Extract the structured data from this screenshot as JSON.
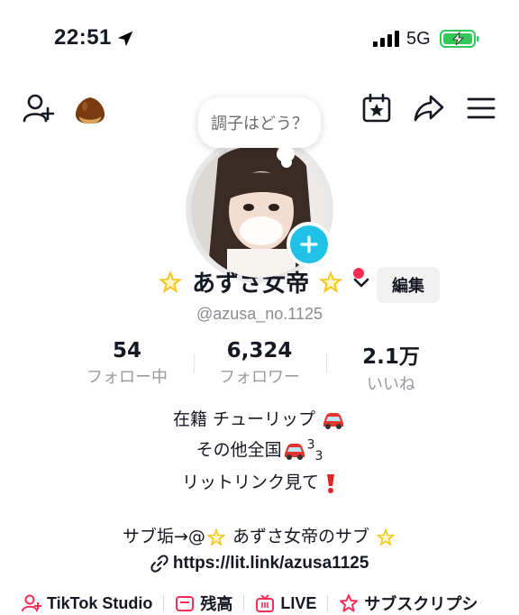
{
  "status_bar": {
    "time": "22:51",
    "network": "5G"
  },
  "toolbar": {
    "left_icons": [
      "add-friend-icon",
      "chestnut-icon"
    ],
    "right_icons": [
      "calendar-star-icon",
      "share-icon",
      "menu-icon"
    ]
  },
  "bubble": {
    "text": "調子はどう？"
  },
  "profile": {
    "name": "あずさ女帝",
    "handle": "@azusa_no.1125",
    "edit_label": "編集"
  },
  "stats": [
    {
      "value": "54",
      "label": "フォロー中"
    },
    {
      "value": "6,324",
      "label": "フォロワー"
    },
    {
      "value": "2.1万",
      "label": "いいね"
    }
  ],
  "bio": {
    "line1": "在籍 チューリップ",
    "line2a": "その他全国",
    "line2b": "3",
    "line2c": "3",
    "line3": "リットリンク見て",
    "line4a": "サブ垢→@",
    "line4b": " あずさ女帝のサブ ",
    "link": "https://lit.link/azusa1125"
  },
  "bottom_tabs": [
    {
      "label": "TikTok Studio",
      "icon": "studio-icon"
    },
    {
      "label": "残高",
      "icon": "wallet-icon"
    },
    {
      "label": "LIVE",
      "icon": "live-icon"
    },
    {
      "label": "サブスクリプシ",
      "icon": "subscription-icon"
    }
  ],
  "colors": {
    "accent_cyan": "#20c3e6",
    "red_dot": "#fe2c55",
    "battery_green": "#34c759"
  }
}
